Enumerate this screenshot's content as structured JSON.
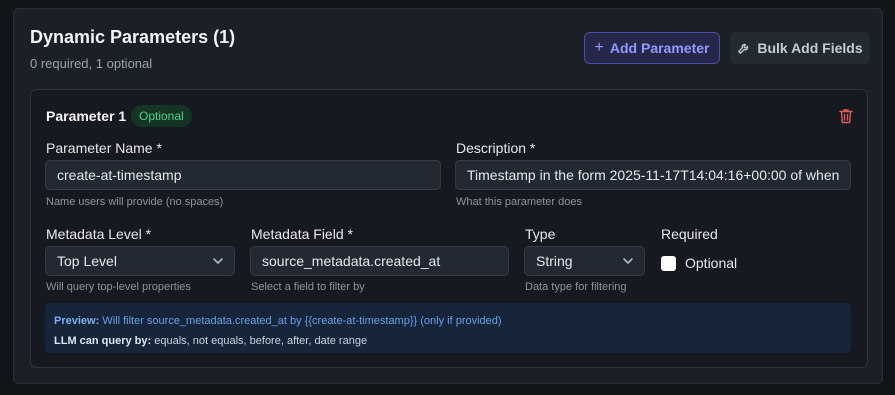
{
  "header": {
    "title": "Dynamic Parameters (1)",
    "subtitle": "0 required, 1 optional",
    "add_button": "Add Parameter",
    "bulk_button": "Bulk Add Fields"
  },
  "parameter": {
    "title": "Parameter 1",
    "badge": "Optional",
    "name": {
      "label": "Parameter Name *",
      "value": "create-at-timestamp",
      "hint": "Name users will provide (no spaces)"
    },
    "description": {
      "label": "Description *",
      "value": "Timestamp in the form 2025-11-17T14:04:16+00:00 of when",
      "hint": "What this parameter does"
    },
    "metadata_level": {
      "label": "Metadata Level *",
      "value": "Top Level",
      "hint": "Will query top-level properties"
    },
    "metadata_field": {
      "label": "Metadata Field *",
      "value": "source_metadata.created_at",
      "hint": "Select a field to filter by"
    },
    "type": {
      "label": "Type",
      "value": "String",
      "hint": "Data type for filtering"
    },
    "required": {
      "label": "Required",
      "checkbox_label": "Optional",
      "checked": false
    },
    "preview": {
      "preview_key": "Preview:",
      "preview_text": "Will filter source_metadata.created_at by {{create-at-timestamp}} (only if provided)",
      "llm_key": "LLM can query by:",
      "llm_text": "equals, not equals, before, after, date range"
    }
  },
  "colors": {
    "accent": "#8f9bff",
    "success": "#4fd18b",
    "danger": "#e05a5a"
  },
  "icons": [
    "plus-icon",
    "wrench-icon",
    "trash-icon",
    "chevron-down-icon"
  ]
}
